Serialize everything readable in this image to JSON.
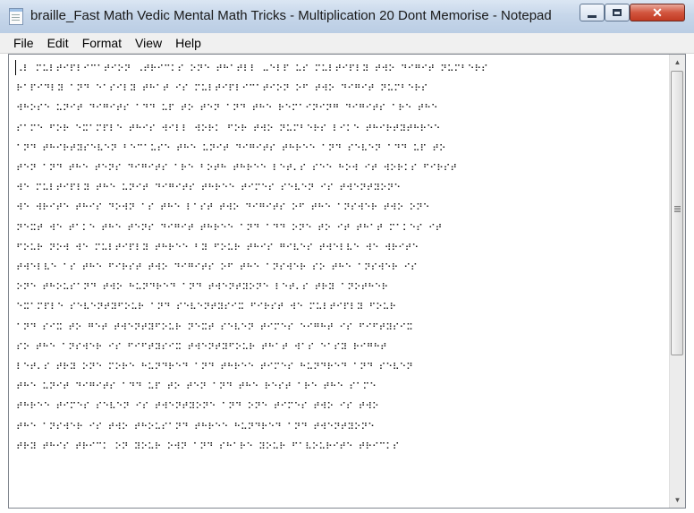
{
  "window": {
    "title": "braille_Fast Math  Vedic Mental Math Tricks - Multiplication 20  Dont Memorise - Notepad",
    "controls": {
      "minimize_icon": "minimize-icon",
      "maximize_icon": "maximize-icon",
      "close_label": "✕"
    }
  },
  "menu": {
    "file": "File",
    "edit": "Edit",
    "format": "Format",
    "view": "View",
    "help": "Help"
  },
  "document": {
    "lines": [
      "⠠⠇ ⠍⠥⠇⠞⠊⠏⠇⠊⠉⠁⠞⠊⠕⠝ ⠠⠞⠗⠊⠉⠅⠎ ⠕⠝⠑ ⠞⠓⠁⠞⠇⠇ ⠤⠑⠇⠏ ⠥⠎ ⠍⠥⠇⠞⠊⠏⠇⠽ ⠞⠺⠕ ⠙⠊⠛⠊⠞ ⠝⠥⠍⠃⠑⠗⠎",
      "⠗⠁⠏⠊⠙⠇⠽ ⠁⠝⠙ ⠑⠁⠎⠊⠇⠽ ⠞⠓⠁⠞ ⠊⠎ ⠍⠥⠇⠞⠊⠏⠇⠊⠉⠁⠞⠊⠕⠝ ⠕⠋ ⠞⠺⠕ ⠙⠊⠛⠊⠞ ⠝⠥⠍⠃⠑⠗⠎",
      "⠺⠓⠕⠎⠑ ⠥⠝⠊⠞ ⠙⠊⠛⠊⠞⠎ ⠁⠙⠙ ⠥⠏ ⠞⠕ ⠞⠑⠝ ⠁⠝⠙ ⠞⠓⠑ ⠗⠑⠍⠁⠊⠝⠊⠝⠛ ⠙⠊⠛⠊⠞⠎ ⠁⠗⠑ ⠞⠓⠑",
      "⠎⠁⠍⠑ ⠋⠕⠗ ⠑⠭⠁⠍⠏⠇⠑ ⠞⠓⠊⠎ ⠺⠊⠇⠇ ⠺⠕⠗⠅ ⠋⠕⠗ ⠞⠺⠕ ⠝⠥⠍⠃⠑⠗⠎ ⠇⠊⠅⠑ ⠞⠓⠊⠗⠞⠽⠞⠓⠗⠑⠑",
      "⠁⠝⠙ ⠞⠓⠊⠗⠞⠽⠎⠑⠧⠑⠝ ⠃⠑⠉⠁⠥⠎⠑ ⠞⠓⠑ ⠥⠝⠊⠞ ⠙⠊⠛⠊⠞⠎ ⠞⠓⠗⠑⠑ ⠁⠝⠙ ⠎⠑⠧⠑⠝ ⠁⠙⠙ ⠥⠏ ⠞⠕",
      "⠞⠑⠝ ⠁⠝⠙ ⠞⠓⠑ ⠞⠑⠝⠎ ⠙⠊⠛⠊⠞⠎ ⠁⠗⠑ ⠃⠕⠞⠓ ⠞⠓⠗⠑⠑ ⠇⠑⠞⠄⠎ ⠎⠑⠑ ⠓⠕⠺ ⠊⠞ ⠺⠕⠗⠅⠎ ⠋⠊⠗⠎⠞",
      "⠺⠑ ⠍⠥⠇⠞⠊⠏⠇⠽ ⠞⠓⠑ ⠥⠝⠊⠞ ⠙⠊⠛⠊⠞⠎ ⠞⠓⠗⠑⠑ ⠞⠊⠍⠑⠎ ⠎⠑⠧⠑⠝ ⠊⠎ ⠞⠺⠑⠝⠞⠽⠕⠝⠑",
      "⠺⠑ ⠺⠗⠊⠞⠑ ⠞⠓⠊⠎ ⠙⠕⠺⠝ ⠁⠎ ⠞⠓⠑ ⠇⠁⠎⠞ ⠞⠺⠕ ⠙⠊⠛⠊⠞⠎ ⠕⠋ ⠞⠓⠑ ⠁⠝⠎⠺⠑⠗ ⠞⠺⠕ ⠕⠝⠑",
      "⠝⠑⠭⠞ ⠺⠑ ⠞⠁⠅⠑ ⠞⠓⠑ ⠞⠑⠝⠎ ⠙⠊⠛⠊⠞ ⠞⠓⠗⠑⠑ ⠁⠝⠙ ⠁⠙⠙ ⠕⠝⠑ ⠞⠕ ⠊⠞ ⠞⠓⠁⠞ ⠍⠁⠅⠑⠎ ⠊⠞",
      "⠋⠕⠥⠗ ⠝⠕⠺ ⠺⠑ ⠍⠥⠇⠞⠊⠏⠇⠽ ⠞⠓⠗⠑⠑ ⠃⠽ ⠋⠕⠥⠗ ⠞⠓⠊⠎ ⠛⠊⠧⠑⠎ ⠞⠺⠑⠇⠧⠑ ⠺⠑ ⠺⠗⠊⠞⠑",
      "⠞⠺⠑⠇⠧⠑ ⠁⠎ ⠞⠓⠑ ⠋⠊⠗⠎⠞ ⠞⠺⠕ ⠙⠊⠛⠊⠞⠎ ⠕⠋ ⠞⠓⠑ ⠁⠝⠎⠺⠑⠗ ⠎⠕ ⠞⠓⠑ ⠁⠝⠎⠺⠑⠗ ⠊⠎",
      "⠕⠝⠑ ⠞⠓⠕⠥⠎⠁⠝⠙ ⠞⠺⠕ ⠓⠥⠝⠙⠗⠑⠙ ⠁⠝⠙ ⠞⠺⠑⠝⠞⠽⠕⠝⠑ ⠇⠑⠞⠄⠎ ⠞⠗⠽ ⠁⠝⠕⠞⠓⠑⠗",
      "⠑⠭⠁⠍⠏⠇⠑ ⠎⠑⠧⠑⠝⠞⠽⠋⠕⠥⠗ ⠁⠝⠙ ⠎⠑⠧⠑⠝⠞⠽⠎⠊⠭ ⠋⠊⠗⠎⠞ ⠺⠑ ⠍⠥⠇⠞⠊⠏⠇⠽ ⠋⠕⠥⠗",
      "⠁⠝⠙ ⠎⠊⠭ ⠞⠕ ⠛⠑⠞ ⠞⠺⠑⠝⠞⠽⠋⠕⠥⠗ ⠝⠑⠭⠞ ⠎⠑⠧⠑⠝ ⠞⠊⠍⠑⠎ ⠑⠊⠛⠓⠞ ⠊⠎ ⠋⠊⠋⠞⠽⠎⠊⠭",
      "⠎⠕ ⠞⠓⠑ ⠁⠝⠎⠺⠑⠗ ⠊⠎ ⠋⠊⠋⠞⠽⠎⠊⠭ ⠞⠺⠑⠝⠞⠽⠋⠕⠥⠗ ⠞⠓⠁⠞ ⠺⠁⠎ ⠑⠁⠎⠽ ⠗⠊⠛⠓⠞",
      "⠇⠑⠞⠄⠎ ⠞⠗⠽ ⠕⠝⠑ ⠍⠕⠗⠑ ⠓⠥⠝⠙⠗⠑⠙ ⠁⠝⠙ ⠞⠓⠗⠑⠑ ⠞⠊⠍⠑⠎ ⠓⠥⠝⠙⠗⠑⠙ ⠁⠝⠙ ⠎⠑⠧⠑⠝",
      "⠞⠓⠑ ⠥⠝⠊⠞ ⠙⠊⠛⠊⠞⠎ ⠁⠙⠙ ⠥⠏ ⠞⠕ ⠞⠑⠝ ⠁⠝⠙ ⠞⠓⠑ ⠗⠑⠎⠞ ⠁⠗⠑ ⠞⠓⠑ ⠎⠁⠍⠑",
      "⠞⠓⠗⠑⠑ ⠞⠊⠍⠑⠎ ⠎⠑⠧⠑⠝ ⠊⠎ ⠞⠺⠑⠝⠞⠽⠕⠝⠑ ⠁⠝⠙ ⠕⠝⠑ ⠞⠊⠍⠑⠎ ⠞⠺⠕ ⠊⠎ ⠞⠺⠕",
      "⠞⠓⠑ ⠁⠝⠎⠺⠑⠗ ⠊⠎ ⠞⠺⠕ ⠞⠓⠕⠥⠎⠁⠝⠙ ⠞⠓⠗⠑⠑ ⠓⠥⠝⠙⠗⠑⠙ ⠁⠝⠙ ⠞⠺⠑⠝⠞⠽⠕⠝⠑",
      "⠞⠗⠽ ⠞⠓⠊⠎ ⠞⠗⠊⠉⠅ ⠕⠝ ⠽⠕⠥⠗ ⠕⠺⠝ ⠁⠝⠙ ⠎⠓⠁⠗⠑ ⠽⠕⠥⠗ ⠋⠁⠧⠕⠥⠗⠊⠞⠑ ⠞⠗⠊⠉⠅⠎"
    ]
  }
}
